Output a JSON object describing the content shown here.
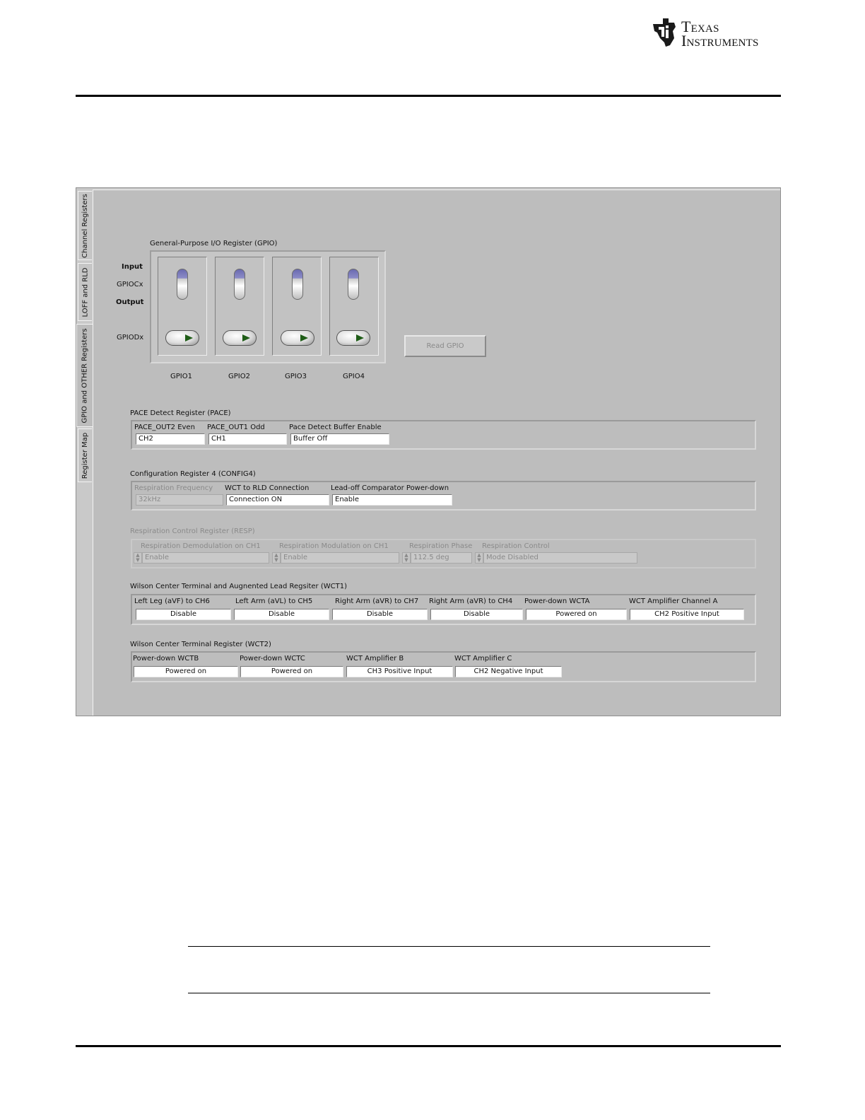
{
  "header": {
    "logo": {
      "line1": "Texas",
      "line2": "Instruments"
    }
  },
  "tabs": [
    {
      "label": "Channel Registers"
    },
    {
      "label": "LOFF and RLD"
    },
    {
      "label": "GPIO and OTHER Registers"
    },
    {
      "label": "Register Map"
    }
  ],
  "gpio": {
    "title": "General-Purpose I/O Register (GPIO)",
    "row_labels": {
      "input": "Input",
      "gpioc": "GPIOCx",
      "output": "Output",
      "gpiod": "GPIODx"
    },
    "channels": [
      {
        "name": "GPIO1"
      },
      {
        "name": "GPIO2"
      },
      {
        "name": "GPIO3"
      },
      {
        "name": "GPIO4"
      }
    ],
    "read_button": "Read GPIO"
  },
  "pace": {
    "title": "PACE Detect Register (PACE)",
    "fields": [
      {
        "label": "PACE_OUT2 Even",
        "value": "CH2"
      },
      {
        "label": "PACE_OUT1 Odd",
        "value": "CH1"
      },
      {
        "label": "Pace Detect Buffer Enable",
        "value": "Buffer Off"
      }
    ]
  },
  "config4": {
    "title": "Configuration Register 4 (CONFIG4)",
    "fields": [
      {
        "label": "Respiration Frequency",
        "value": "32kHz"
      },
      {
        "label": "WCT to RLD Connection",
        "value": "Connection ON"
      },
      {
        "label": "Lead-off Comparator Power-down",
        "value": "Enable"
      }
    ]
  },
  "resp": {
    "title": "Respiration Control Register (RESP)",
    "fields": [
      {
        "label": "Respiration Demodulation on CH1",
        "value": "Enable"
      },
      {
        "label": "Respiration Modulation on CH1",
        "value": "Enable"
      },
      {
        "label": "Respiration Phase",
        "value": "112.5 deg"
      },
      {
        "label": "Respiration Control",
        "value": "Mode Disabled"
      }
    ]
  },
  "wct1": {
    "title": "Wilson Center Terminal and Augnented Lead Regsiter (WCT1)",
    "fields": [
      {
        "label": "Left Leg (aVF) to CH6",
        "value": "Disable"
      },
      {
        "label": "Left Arm (aVL) to CH5",
        "value": "Disable"
      },
      {
        "label": "Right Arm (aVR) to CH7",
        "value": "Disable"
      },
      {
        "label": "Right Arm (aVR) to CH4",
        "value": "Disable"
      },
      {
        "label": "Power-down WCTA",
        "value": "Powered on"
      },
      {
        "label": "WCT Amplifier Channel A",
        "value": "CH2 Positive Input"
      }
    ]
  },
  "wct2": {
    "title": "Wilson Center Terminal Register (WCT2)",
    "fields": [
      {
        "label": "Power-down WCTB",
        "value": "Powered on"
      },
      {
        "label": "Power-down WCTC",
        "value": "Powered on"
      },
      {
        "label": "WCT Amplifier B",
        "value": "CH3 Positive Input"
      },
      {
        "label": "WCT Amplifier C",
        "value": "CH2 Negative Input"
      }
    ]
  }
}
